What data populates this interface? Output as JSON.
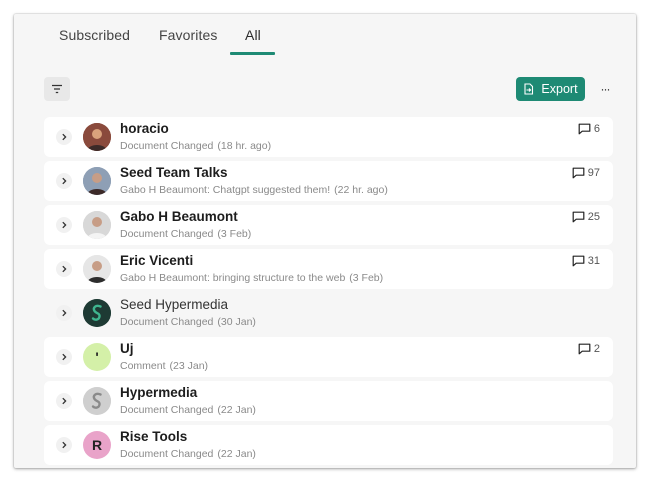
{
  "tabs": [
    {
      "label": "Subscribed",
      "active": false
    },
    {
      "label": "Favorites",
      "active": false
    },
    {
      "label": "All",
      "active": true
    }
  ],
  "toolbar": {
    "filter_icon": "filter-lines-icon",
    "export_label": "Export",
    "export_icon": "document-export-icon",
    "more_label": "···",
    "accent_color": "#1e8a74"
  },
  "items": [
    {
      "title": "horacio",
      "subtitle": "Document Changed",
      "time": "(18 hr. ago)",
      "comments": "6",
      "avatar": "photo",
      "avatar_color": "#8a4a3c"
    },
    {
      "title": "Seed Team Talks",
      "subtitle": "Gabo H Beaumont: Chatgpt suggested them!",
      "time": "(22 hr. ago)",
      "comments": "97",
      "avatar": "photo",
      "avatar_color": "#8e9fb5"
    },
    {
      "title": "Gabo H Beaumont",
      "subtitle": "Document Changed",
      "time": "(3 Feb)",
      "comments": "25",
      "avatar": "photo",
      "avatar_color": "#d8d8d8"
    },
    {
      "title": "Eric Vicenti",
      "subtitle": "Gabo H Beaumont: bringing structure to the web",
      "time": "(3 Feb)",
      "comments": "31",
      "avatar": "photo",
      "avatar_color": "#e6e6e6"
    },
    {
      "title": "Seed Hypermedia",
      "subtitle": "Document Changed",
      "time": "(30 Jan)",
      "comments": "",
      "avatar": "logo-s",
      "avatar_color": "#1e3a34"
    },
    {
      "title": "Uj",
      "subtitle": "Comment",
      "time": "(23 Jan)",
      "comments": "2",
      "avatar": "letter",
      "avatar_color": "#d4f0a8",
      "avatar_letter": "'"
    },
    {
      "title": "Hypermedia",
      "subtitle": "Document Changed",
      "time": "(22 Jan)",
      "comments": "",
      "avatar": "logo-s",
      "avatar_color": "#cfcfcf"
    },
    {
      "title": "Rise Tools",
      "subtitle": "Document Changed",
      "time": "(22 Jan)",
      "comments": "",
      "avatar": "letter",
      "avatar_color": "#e9a3c9",
      "avatar_letter": "R"
    }
  ]
}
